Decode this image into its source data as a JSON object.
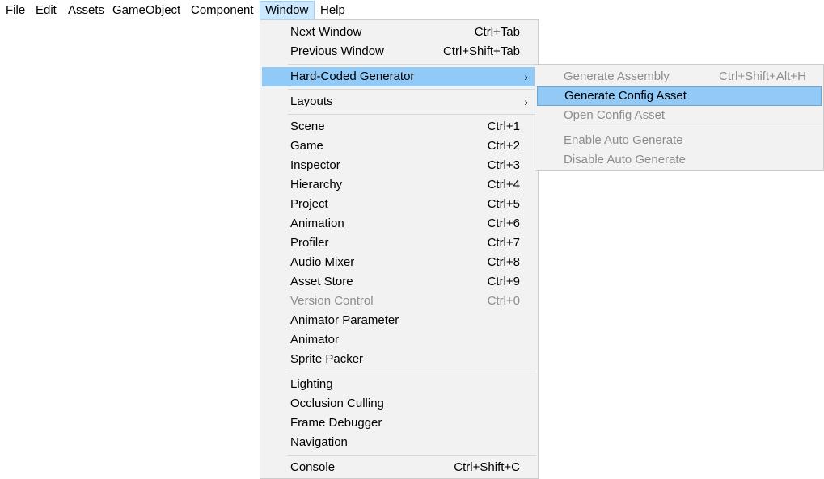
{
  "menubar": {
    "items": [
      "File",
      "Edit",
      "Assets",
      "GameObject",
      "Component",
      "Window",
      "Help"
    ]
  },
  "window_menu": {
    "items": [
      {
        "label": "Next Window",
        "shortcut": "Ctrl+Tab"
      },
      {
        "label": "Previous Window",
        "shortcut": "Ctrl+Shift+Tab"
      },
      {
        "label": "Hard-Coded Generator",
        "shortcut": ""
      },
      {
        "label": "Layouts",
        "shortcut": ""
      },
      {
        "label": "Scene",
        "shortcut": "Ctrl+1"
      },
      {
        "label": "Game",
        "shortcut": "Ctrl+2"
      },
      {
        "label": "Inspector",
        "shortcut": "Ctrl+3"
      },
      {
        "label": "Hierarchy",
        "shortcut": "Ctrl+4"
      },
      {
        "label": "Project",
        "shortcut": "Ctrl+5"
      },
      {
        "label": "Animation",
        "shortcut": "Ctrl+6"
      },
      {
        "label": "Profiler",
        "shortcut": "Ctrl+7"
      },
      {
        "label": "Audio Mixer",
        "shortcut": "Ctrl+8"
      },
      {
        "label": "Asset Store",
        "shortcut": "Ctrl+9"
      },
      {
        "label": "Version Control",
        "shortcut": "Ctrl+0"
      },
      {
        "label": "Animator Parameter",
        "shortcut": ""
      },
      {
        "label": "Animator",
        "shortcut": ""
      },
      {
        "label": "Sprite Packer",
        "shortcut": ""
      },
      {
        "label": "Lighting",
        "shortcut": ""
      },
      {
        "label": "Occlusion Culling",
        "shortcut": ""
      },
      {
        "label": "Frame Debugger",
        "shortcut": ""
      },
      {
        "label": "Navigation",
        "shortcut": ""
      },
      {
        "label": "Console",
        "shortcut": "Ctrl+Shift+C"
      }
    ],
    "submenu_arrow": "›"
  },
  "submenu": {
    "items": [
      {
        "label": "Generate Assembly",
        "shortcut": "Ctrl+Shift+Alt+H"
      },
      {
        "label": "Generate Config Asset",
        "shortcut": ""
      },
      {
        "label": "Open Config Asset",
        "shortcut": ""
      },
      {
        "label": "Enable Auto Generate",
        "shortcut": ""
      },
      {
        "label": "Disable Auto Generate",
        "shortcut": ""
      }
    ]
  },
  "colors": {
    "menu_bg": "#f2f2f2",
    "highlight": "#91c9f7",
    "menubar_active": "#cce8ff",
    "disabled_text": "#8d8d8d"
  }
}
